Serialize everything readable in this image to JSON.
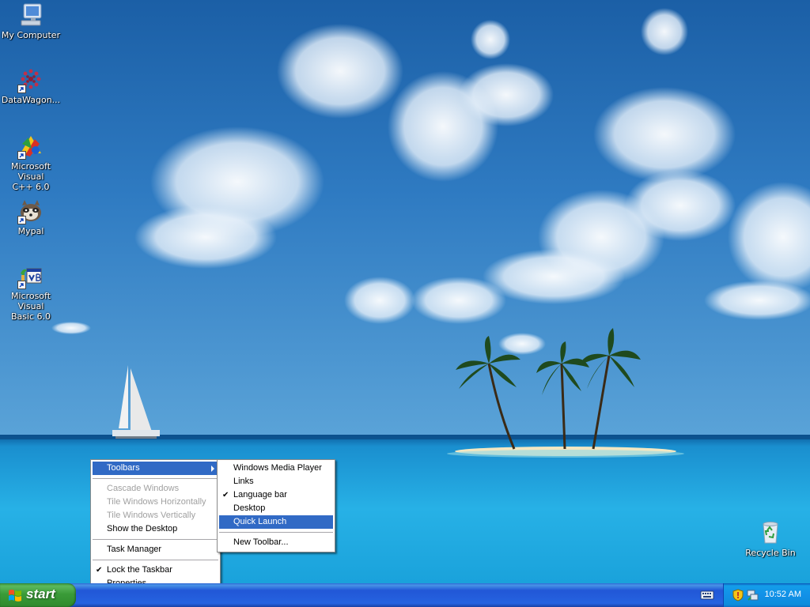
{
  "desktop": {
    "icons": [
      {
        "label": "My Computer",
        "icon": "my-computer-icon"
      },
      {
        "label": "DataWagon...",
        "icon": "datawagon-icon"
      },
      {
        "label": "Microsoft Visual\nC++ 6.0",
        "icon": "visual-cpp-icon"
      },
      {
        "label": "Mypal",
        "icon": "mypal-icon"
      },
      {
        "label": "Microsoft Visual\nBasic 6.0",
        "icon": "visual-basic-icon"
      },
      {
        "label": "Recycle Bin",
        "icon": "recycle-bin-icon"
      }
    ]
  },
  "context_menu": {
    "items": [
      {
        "label": "Toolbars",
        "highlighted": true,
        "submenu": true
      },
      {
        "label": "Cascade Windows",
        "disabled": true
      },
      {
        "label": "Tile Windows Horizontally",
        "disabled": true
      },
      {
        "label": "Tile Windows Vertically",
        "disabled": true
      },
      {
        "label": "Show the Desktop"
      },
      {
        "label": "Task Manager"
      },
      {
        "label": "Lock the Taskbar",
        "checked": true
      },
      {
        "label": "Properties"
      }
    ]
  },
  "toolbars_submenu": {
    "items": [
      {
        "label": "Windows Media Player"
      },
      {
        "label": "Links"
      },
      {
        "label": "Language bar",
        "checked": true
      },
      {
        "label": "Desktop"
      },
      {
        "label": "Quick Launch",
        "highlighted": true
      },
      {
        "label": "New Toolbar..."
      }
    ]
  },
  "taskbar": {
    "start_label": "start",
    "clock": "10:52 AM",
    "colors": {
      "taskbar": "#245edb",
      "start": "#3c9a3c",
      "tray": "#0f8ee0",
      "highlight": "#316ac5"
    }
  },
  "symbols": {
    "check": "✔"
  }
}
